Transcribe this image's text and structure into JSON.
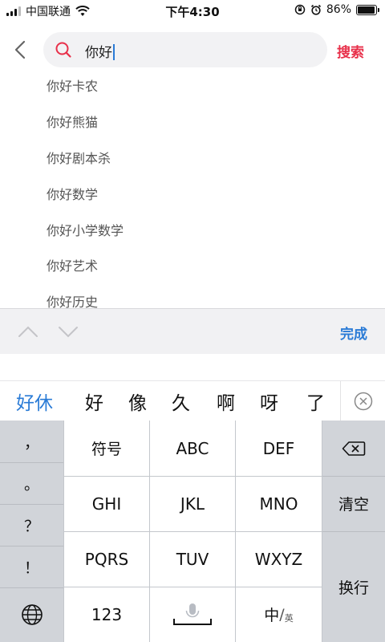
{
  "status_bar": {
    "carrier": "中国联通",
    "time": "下午4:30",
    "battery_percent": "86%",
    "battery_level": 0.86,
    "icons": [
      "signal-icon",
      "wifi-icon",
      "orientation-lock-icon",
      "alarm-icon",
      "battery-icon"
    ]
  },
  "search": {
    "query": "你好",
    "search_button": "搜索"
  },
  "suggestions": [
    "你好卡农",
    "你好熊猫",
    "你好剧本杀",
    "你好数学",
    "你好小学数学",
    "你好艺术",
    "你好历史"
  ],
  "accessory": {
    "done_label": "完成"
  },
  "candidates": [
    "好休",
    "好",
    "像",
    "久",
    "啊",
    "呀",
    "了"
  ],
  "keyboard": {
    "left_column": [
      "，",
      "。",
      "？",
      "！"
    ],
    "rows": [
      [
        "符号",
        "ABC",
        "DEF"
      ],
      [
        "GHI",
        "JKL",
        "MNO"
      ],
      [
        "PQRS",
        "TUV",
        "WXYZ"
      ]
    ],
    "bottom": {
      "numbers": "123",
      "lang_main": "中",
      "lang_sep": "/",
      "lang_alt": "英"
    },
    "clear": "清空",
    "enter": "换行"
  },
  "colors": {
    "accent_blue": "#2a7bd6",
    "search_red": "#e8304a",
    "keyboard_gray": "#d1d4d9"
  }
}
